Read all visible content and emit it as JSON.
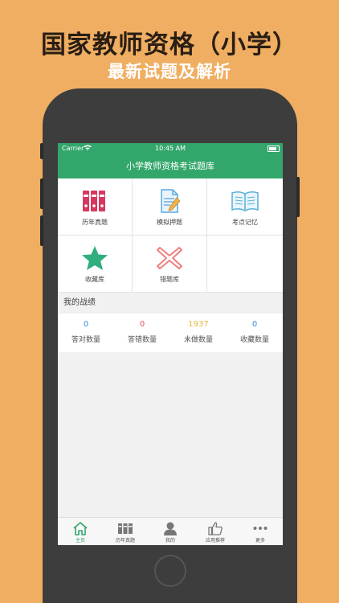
{
  "promo": {
    "title": "国家教师资格（小学）",
    "subtitle": "最新试题及解析"
  },
  "status_bar": {
    "carrier": "Carrier",
    "time": "10:45 AM"
  },
  "nav": {
    "title": "小学教师资格考试题库"
  },
  "grid": [
    {
      "label": "历年真题",
      "icon": "binders-icon"
    },
    {
      "label": "模拟押题",
      "icon": "document-pencil-icon"
    },
    {
      "label": "考点记忆",
      "icon": "open-book-icon"
    },
    {
      "label": "收藏库",
      "icon": "star-icon"
    },
    {
      "label": "错题库",
      "icon": "x-mark-icon"
    }
  ],
  "section": {
    "title": "我的战绩"
  },
  "stats": [
    {
      "value": "0",
      "label": "答对数量",
      "color": "#3B8FD9"
    },
    {
      "value": "0",
      "label": "答错数量",
      "color": "#E0525A"
    },
    {
      "value": "1937",
      "label": "未做数量",
      "color": "#E8B43A"
    },
    {
      "value": "0",
      "label": "收藏数量",
      "color": "#3B8FD9"
    }
  ],
  "tabs": [
    {
      "label": "主页",
      "icon": "home-icon",
      "active": true
    },
    {
      "label": "历年真题",
      "icon": "books-icon",
      "active": false
    },
    {
      "label": "我的",
      "icon": "user-icon",
      "active": false
    },
    {
      "label": "应用推荐",
      "icon": "thumbs-up-icon",
      "active": false
    },
    {
      "label": "更多",
      "icon": "more-dots-icon",
      "active": false
    }
  ],
  "colors": {
    "background": "#EFAE62",
    "accent": "#33A66B",
    "phone": "#3D3D3D"
  }
}
